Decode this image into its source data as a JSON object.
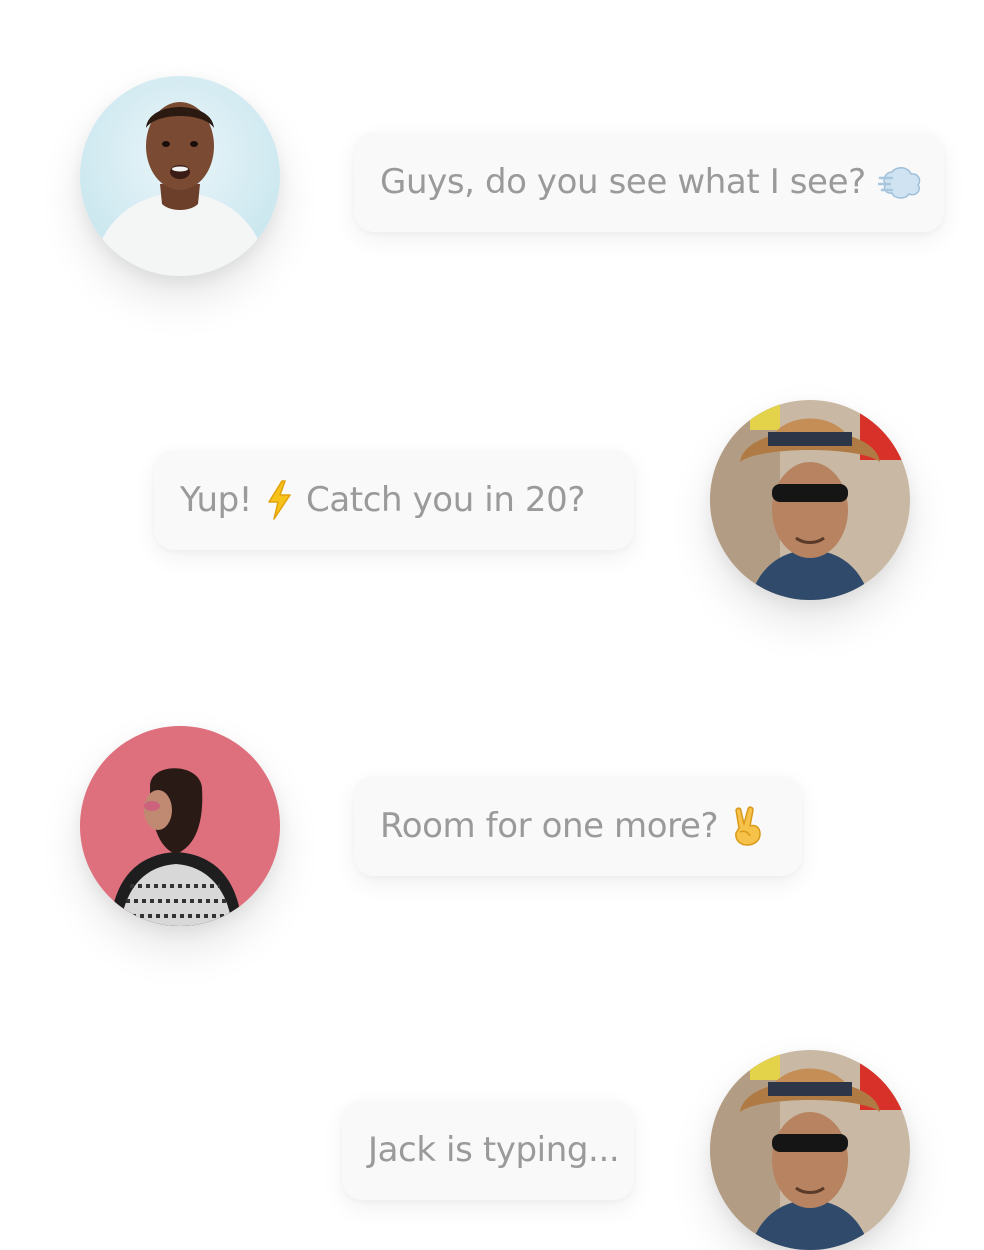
{
  "messages": [
    {
      "sender": "left",
      "text": "Guys, do you see what I see?",
      "emoji": "dash-emoji"
    },
    {
      "sender": "right",
      "text_before": "Yup!",
      "emoji": "lightning-emoji",
      "text_after": "Catch you in 20?"
    },
    {
      "sender": "left",
      "text": "Room for one more?",
      "emoji": "victory-hand-emoji"
    }
  ],
  "typing_indicator": {
    "text": "Jack is typing..."
  },
  "colors": {
    "bubble_background": "#f9f9f9",
    "bubble_text": "#9a9a9a",
    "page_background": "#ffffff"
  }
}
